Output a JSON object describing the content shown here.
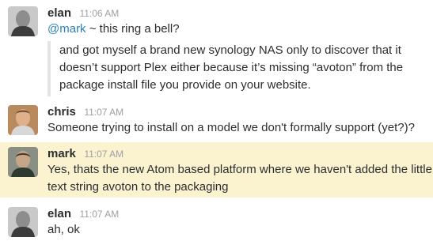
{
  "messages": [
    {
      "author": "elan",
      "time": "11:06 AM",
      "mention": "@mark",
      "text": " ~ this ring a bell?",
      "quote": [
        "and got myself a brand new synology NAS only to discover that it",
        "doesn’t support Plex either because it’s missing “avoton” from the",
        "package install file you provide on your website."
      ]
    },
    {
      "author": "chris",
      "time": "11:07 AM",
      "text": "Someone trying to install on a model we don't formally support (yet?)?"
    },
    {
      "author": "mark",
      "time": "11:07 AM",
      "lines": [
        "Yes, thats the new Atom based platform where we haven't added the little",
        "text string avoton to the packaging"
      ]
    },
    {
      "author": "elan",
      "time": "11:07 AM",
      "text": "ah, ok"
    }
  ],
  "colors": {
    "highlight": "#fbf3d0",
    "mention": "#2a80b9",
    "timestamp": "#9e9ea6",
    "quote_bar": "#e3e4e6"
  }
}
